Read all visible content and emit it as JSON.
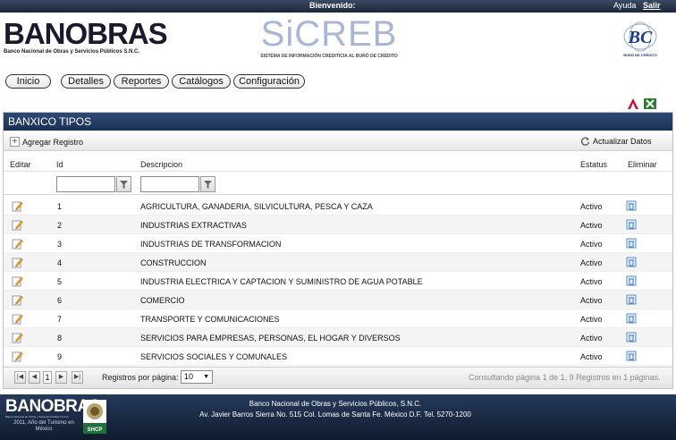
{
  "topbar": {
    "welcome": "Bienvenido:",
    "help": "Ayuda",
    "logout": "Salir"
  },
  "header": {
    "bank_logo": "BANOBRAS",
    "bank_subtitle": "Banco Nacional de Obras y Servicios Públicos S.N.C.",
    "app_logo": "SiCREB",
    "app_subtitle": "SISTEMA DE INFORMACIÓN CREDITICIA AL BURÓ DE CRÉDITO",
    "bureau_logo": "BC",
    "bureau_caption": "BURÓ DE CRÉDITO"
  },
  "nav": {
    "items": [
      "Inicio",
      "Detalles",
      "Reportes",
      "Catálogos",
      "Configuración"
    ]
  },
  "tools": {
    "pdf_icon": "pdf-export-icon",
    "excel_icon": "excel-export-icon"
  },
  "panel": {
    "title": "BANXICO TIPOS",
    "add_label": "Agregar Registro",
    "refresh_label": "Actualizar Datos",
    "columns": {
      "edit": "Editar",
      "id": "Id",
      "description": "Descripcion",
      "status": "Estatus",
      "delete": "Eliminar"
    },
    "filters": {
      "id_value": "",
      "description_value": ""
    },
    "rows": [
      {
        "id": "1",
        "description": "AGRICULTURA, GANADERIA, SILVICULTURA, PESCA Y CAZA",
        "status": "Activo"
      },
      {
        "id": "2",
        "description": "INDUSTRIAS EXTRACTIVAS",
        "status": "Activo"
      },
      {
        "id": "3",
        "description": "INDUSTRIAS DE TRANSFORMACION",
        "status": "Activo"
      },
      {
        "id": "4",
        "description": "CONSTRUCCION",
        "status": "Activo"
      },
      {
        "id": "5",
        "description": "INDUSTRIA ELECTRICA Y CAPTACION Y SUMINISTRO DE AGUA POTABLE",
        "status": "Activo"
      },
      {
        "id": "6",
        "description": "COMERCIO",
        "status": "Activo"
      },
      {
        "id": "7",
        "description": "TRANSPORTE Y COMUNICACIONES",
        "status": "Activo"
      },
      {
        "id": "8",
        "description": "SERVICIOS PARA EMPRESAS, PERSONAS, EL HOGAR Y DIVERSOS",
        "status": "Activo"
      },
      {
        "id": "9",
        "description": "SERVICIOS SOCIALES Y COMUNALES",
        "status": "Activo"
      }
    ],
    "pager": {
      "current_page": "1",
      "page_size_label": "Registros por página:",
      "page_size": "10",
      "info": "Consultando página 1 de 1, 9 Registros en 1 páginas."
    }
  },
  "footer": {
    "logo": "BANOBRAS",
    "logo_sub": "Banco Nacional de Obras y Servicios Públicos S.N.C.",
    "year_text": "2011, Año del Turismo en México",
    "seal_caption": "SHCP",
    "line1": "Banco Nacional de Obras y Servicios Públicos, S.N.C.",
    "line2": "Av. Javier Barros Sierra No. 515 Col. Lomas de Santa Fe. México D.F. Tel. 5270-1200"
  },
  "colors": {
    "header_dark": "#1b3156",
    "accent_blue": "#2e4a74",
    "status_text": "#111111"
  }
}
